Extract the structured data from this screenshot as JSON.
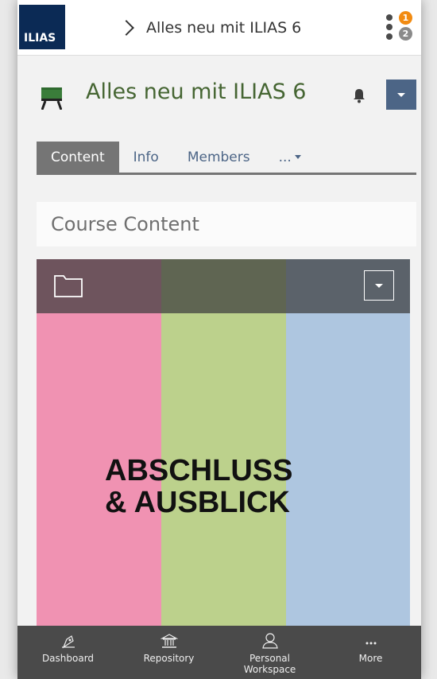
{
  "topbar": {
    "logo_text": "ILIAS",
    "breadcrumb": "Alles neu mit ILIAS 6",
    "badges": [
      {
        "count": "1",
        "color": "#f28b12"
      },
      {
        "count": "2",
        "color": "#8a8a8a"
      }
    ]
  },
  "header": {
    "title": "Alles neu mit ILIAS 6",
    "title_color": "#456532",
    "icon": "course-board-icon"
  },
  "tabs": [
    {
      "label": "Content",
      "active": true
    },
    {
      "label": "Info",
      "active": false
    },
    {
      "label": "Members",
      "active": false
    },
    {
      "label": "...",
      "active": false
    }
  ],
  "content": {
    "section_title": "Course Content",
    "tile": {
      "heading_line1": "ABSCHLUSS",
      "heading_line2": "& AUSBLICK",
      "stripe_colors": [
        "#f092b2",
        "#bcd18c",
        "#aec6e0"
      ]
    }
  },
  "bottom_nav": [
    {
      "label": "Dashboard",
      "icon": "dashboard-icon"
    },
    {
      "label": "Repository",
      "icon": "repository-icon"
    },
    {
      "label_line1": "Personal",
      "label_line2": "Workspace",
      "icon": "personal-workspace-icon"
    },
    {
      "label": "More",
      "icon": "more-icon"
    }
  ],
  "colors": {
    "accent_blue": "#4c6586",
    "bottom_nav_bg": "#4a4a4a",
    "logo_bg": "#0b2a55"
  }
}
